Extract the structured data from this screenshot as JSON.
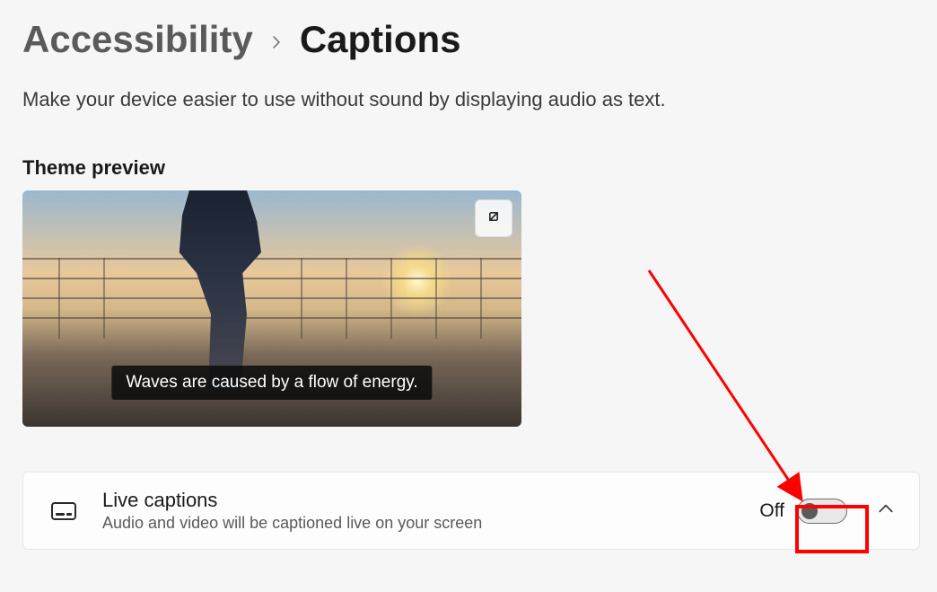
{
  "breadcrumb": {
    "parent": "Accessibility",
    "current": "Captions"
  },
  "description": "Make your device easier to use without sound by displaying audio as text.",
  "preview": {
    "section_title": "Theme preview",
    "caption_text": "Waves are caused by a flow of energy."
  },
  "setting": {
    "title": "Live captions",
    "subtitle": "Audio and video will be captioned live on your screen",
    "toggle_state_label": "Off"
  }
}
